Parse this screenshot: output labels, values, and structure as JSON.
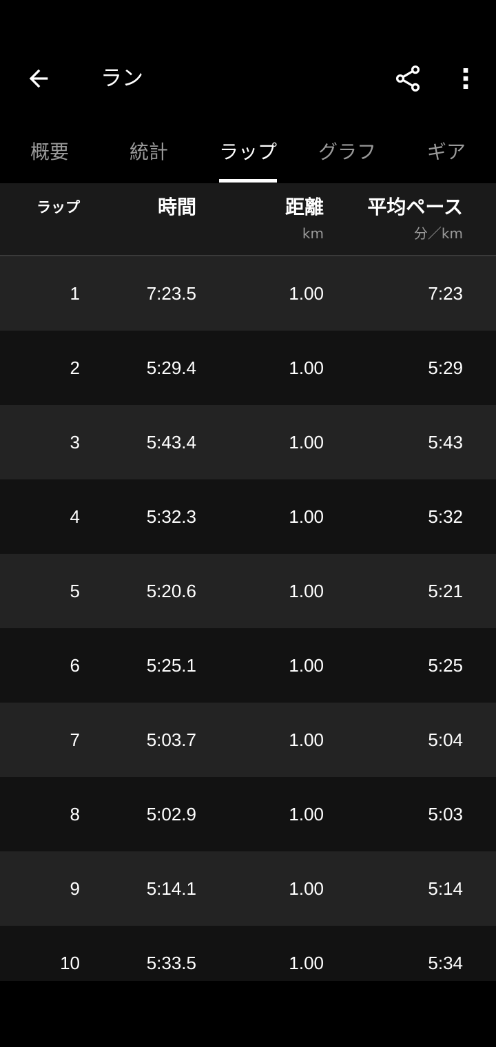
{
  "toolbar": {
    "title": "ラン",
    "back_icon": "arrow-left-icon",
    "share_icon": "share-icon",
    "more_icon": "more-vert-icon"
  },
  "tabs": [
    {
      "label": "概要",
      "active": false
    },
    {
      "label": "統計",
      "active": false
    },
    {
      "label": "ラップ",
      "active": true
    },
    {
      "label": "グラフ",
      "active": false
    },
    {
      "label": "ギア",
      "active": false
    }
  ],
  "table": {
    "headers": {
      "lap": "ラップ",
      "time": "時間",
      "distance": "距離",
      "distance_unit": "km",
      "pace": "平均ペース",
      "pace_unit": "分／km"
    },
    "rows": [
      {
        "lap": "1",
        "time": "7:23.5",
        "distance": "1.00",
        "pace": "7:23"
      },
      {
        "lap": "2",
        "time": "5:29.4",
        "distance": "1.00",
        "pace": "5:29"
      },
      {
        "lap": "3",
        "time": "5:43.4",
        "distance": "1.00",
        "pace": "5:43"
      },
      {
        "lap": "4",
        "time": "5:32.3",
        "distance": "1.00",
        "pace": "5:32"
      },
      {
        "lap": "5",
        "time": "5:20.6",
        "distance": "1.00",
        "pace": "5:21"
      },
      {
        "lap": "6",
        "time": "5:25.1",
        "distance": "1.00",
        "pace": "5:25"
      },
      {
        "lap": "7",
        "time": "5:03.7",
        "distance": "1.00",
        "pace": "5:04"
      },
      {
        "lap": "8",
        "time": "5:02.9",
        "distance": "1.00",
        "pace": "5:03"
      },
      {
        "lap": "9",
        "time": "5:14.1",
        "distance": "1.00",
        "pace": "5:14"
      },
      {
        "lap": "10",
        "time": "5:33.5",
        "distance": "1.00",
        "pace": "5:34"
      }
    ]
  },
  "colors": {
    "background": "#000000",
    "header_bg": "#1a1a1a",
    "row_odd": "#232323",
    "row_even": "#121212",
    "inactive_tab": "#9a9a9a"
  }
}
